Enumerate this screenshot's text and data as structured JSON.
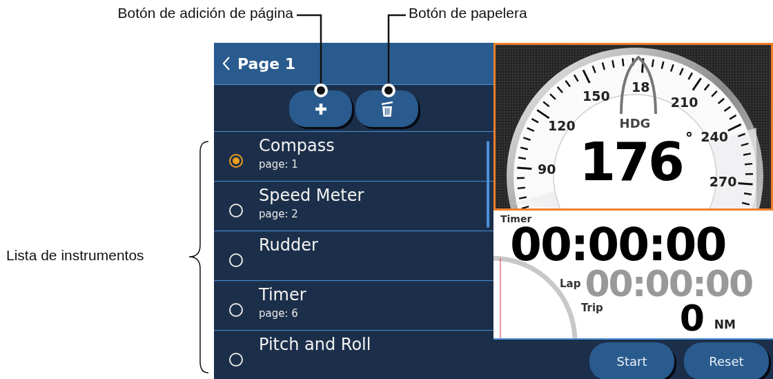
{
  "annotations": [
    {
      "kind": "callout",
      "text": "Botón de adición de página"
    },
    {
      "kind": "callout",
      "text": "Botón de papelera"
    },
    {
      "kind": "brace",
      "text": "Lista de instrumentos"
    }
  ],
  "header": {
    "title": "Page 1"
  },
  "instruments": [
    {
      "name": "Compass",
      "page": "page: 1",
      "selected": true
    },
    {
      "name": "Speed Meter",
      "page": "page: 2",
      "selected": false
    },
    {
      "name": "Rudder",
      "selected": false
    },
    {
      "name": "Timer",
      "page": "page: 6",
      "selected": false
    },
    {
      "name": "Pitch and Roll",
      "selected": false
    }
  ],
  "compass": {
    "label": "HDG",
    "heading": "176",
    "unit": "°",
    "dial_labels": [
      "90",
      "120",
      "150",
      "18",
      "210",
      "240",
      "270"
    ]
  },
  "timer": {
    "title": "Timer",
    "time": "00:00:00",
    "lap_label": "Lap",
    "lap_time": "00:00:00",
    "trip_label": "Trip",
    "trip_value": "0",
    "trip_unit": "NM"
  },
  "buttons": [
    {
      "label": "Start"
    },
    {
      "label": "Reset"
    }
  ]
}
